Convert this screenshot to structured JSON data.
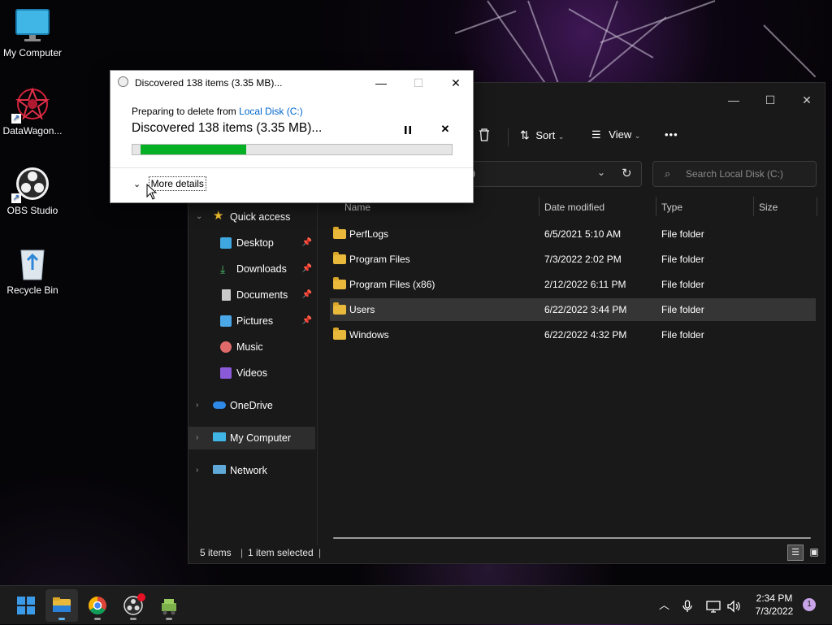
{
  "desktop": {
    "icons": [
      {
        "label": "My Computer",
        "icon": "monitor-icon"
      },
      {
        "label": "DataWagon...",
        "icon": "datawagon-icon"
      },
      {
        "label": "OBS Studio",
        "icon": "obs-icon"
      },
      {
        "label": "Recycle Bin",
        "icon": "recycle-bin-icon"
      }
    ]
  },
  "dialog": {
    "title": "Discovered 138 items (3.35 MB)...",
    "preparing_prefix": "Preparing to delete from ",
    "preparing_link": "Local Disk (C:)",
    "status": "Discovered 138 items (3.35 MB)...",
    "progress": 0.34,
    "more_details": "More details",
    "controls": {
      "minimize": "—",
      "maximize": "☐",
      "close": "✕"
    },
    "pause_icon": "pause-icon",
    "cancel_icon": "cancel-icon"
  },
  "explorer": {
    "controls": {
      "minimize": "—",
      "maximize": "☐",
      "close": "✕"
    },
    "toolbar": {
      "sort_label": "Sort",
      "view_label": "View",
      "more": "•••"
    },
    "address_partial": ")",
    "search_placeholder": "Search Local Disk (C:)",
    "nav": {
      "quick_access": "Quick access",
      "pinned": [
        {
          "label": "Desktop",
          "icon": "desktop-icon",
          "pinned": true
        },
        {
          "label": "Downloads",
          "icon": "downloads-icon",
          "pinned": true
        },
        {
          "label": "Documents",
          "icon": "documents-icon",
          "pinned": true
        },
        {
          "label": "Pictures",
          "icon": "pictures-icon",
          "pinned": true
        },
        {
          "label": "Music",
          "icon": "music-icon",
          "pinned": false
        },
        {
          "label": "Videos",
          "icon": "videos-icon",
          "pinned": false
        }
      ],
      "onedrive": "OneDrive",
      "my_computer": "My Computer",
      "network": "Network"
    },
    "columns": {
      "name": "Name",
      "date": "Date modified",
      "type": "Type",
      "size": "Size"
    },
    "rows": [
      {
        "name": "PerfLogs",
        "date": "6/5/2021 5:10 AM",
        "type": "File folder",
        "selected": false
      },
      {
        "name": "Program Files",
        "date": "7/3/2022 2:02 PM",
        "type": "File folder",
        "selected": false
      },
      {
        "name": "Program Files (x86)",
        "date": "2/12/2022 6:11 PM",
        "type": "File folder",
        "selected": false
      },
      {
        "name": "Users",
        "date": "6/22/2022 3:44 PM",
        "type": "File folder",
        "selected": true
      },
      {
        "name": "Windows",
        "date": "6/22/2022 4:32 PM",
        "type": "File folder",
        "selected": false
      }
    ],
    "status": {
      "items": "5 items",
      "selected": "1 item selected"
    }
  },
  "taskbar": {
    "time": "2:34 PM",
    "date": "7/3/2022",
    "notification_count": "1"
  },
  "colors": {
    "accent_link": "#0066cc",
    "progress_green": "#06b025",
    "folder_yellow": "#e8b93b",
    "taskbar_bg": "#1c1c1c",
    "explorer_bg": "#191919"
  }
}
